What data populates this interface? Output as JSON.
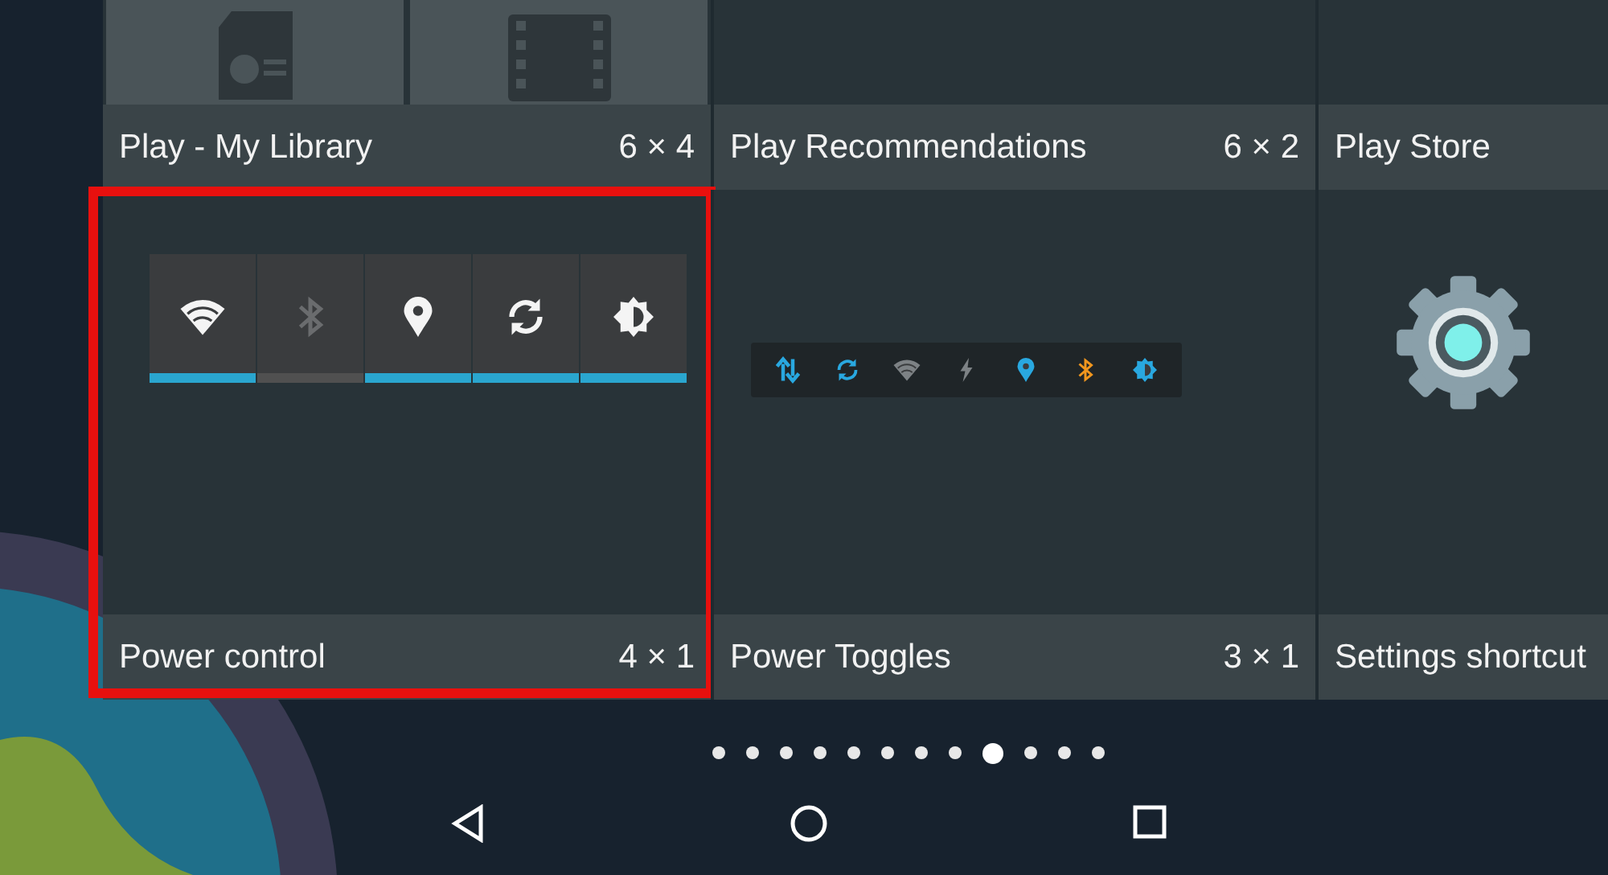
{
  "widgets_top": [
    {
      "name": "Play - My Library",
      "size": "6 × 4",
      "kind": "library"
    },
    {
      "name": "Play Recommendations",
      "size": "6 × 2",
      "kind": "plain"
    },
    {
      "name": "Play Store",
      "kind": "plain"
    }
  ],
  "widgets": [
    {
      "name": "Power control",
      "size": "4 × 1",
      "highlighted": true,
      "kind": "power_control",
      "toggles": [
        {
          "kind": "wifi",
          "on": true
        },
        {
          "kind": "bluetooth",
          "on": false
        },
        {
          "kind": "location",
          "on": true
        },
        {
          "kind": "sync",
          "on": true
        },
        {
          "kind": "brightness",
          "on": true
        }
      ]
    },
    {
      "name": "Power Toggles",
      "size": "3 × 1",
      "highlighted": false,
      "kind": "power_toggles",
      "icons": [
        {
          "kind": "data",
          "color": "#29a8e0"
        },
        {
          "kind": "sync",
          "color": "#29a8e0"
        },
        {
          "kind": "wifi",
          "color": "#7d8285"
        },
        {
          "kind": "flash",
          "color": "#7d8285"
        },
        {
          "kind": "location",
          "color": "#29a8e0"
        },
        {
          "kind": "bluetooth",
          "color": "#f0961e"
        },
        {
          "kind": "brightness",
          "color": "#29a8e0"
        }
      ]
    },
    {
      "name": "Settings shortcut",
      "highlighted": false,
      "kind": "settings"
    }
  ],
  "pages": [
    {
      "selected": false
    },
    {
      "selected": false
    },
    {
      "selected": false
    },
    {
      "selected": false
    },
    {
      "selected": false
    },
    {
      "selected": false
    },
    {
      "selected": false
    },
    {
      "selected": false
    },
    {
      "selected": true
    },
    {
      "selected": false
    },
    {
      "selected": false
    },
    {
      "selected": false
    }
  ],
  "nav_buttons": [
    {
      "kind": "back"
    },
    {
      "kind": "home"
    },
    {
      "kind": "recents"
    }
  ]
}
